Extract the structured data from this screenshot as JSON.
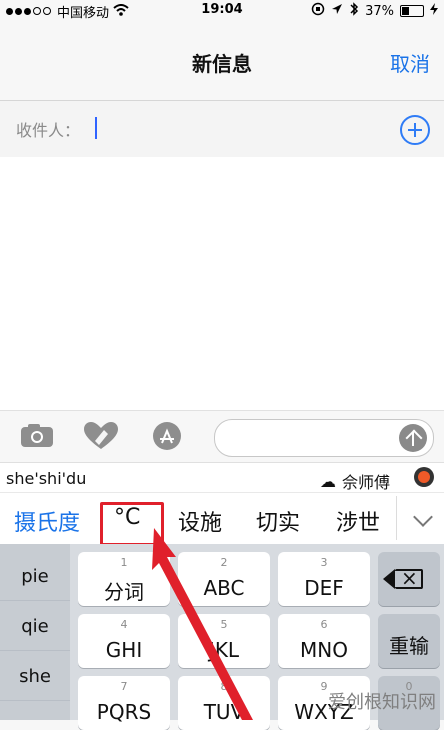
{
  "status": {
    "carrier": "中国移动",
    "time": "19:04",
    "battery_percent": "37%",
    "battery_level": 0.37
  },
  "navbar": {
    "title": "新信息",
    "cancel": "取消"
  },
  "recipient": {
    "label": "收件人："
  },
  "composer": {
    "icons": [
      "camera-icon",
      "digital-touch-icon",
      "app-store-icon",
      "send-icon"
    ]
  },
  "keyboard": {
    "pinyin": "she'shi'du",
    "account": "佘师傅",
    "candidates": [
      "摄氏度",
      "°C",
      "设施",
      "切实",
      "涉世"
    ],
    "side_items": [
      "pie",
      "qie",
      "she"
    ],
    "keys": {
      "row1": [
        {
          "num": "1",
          "label": "分词"
        },
        {
          "num": "2",
          "label": "ABC"
        },
        {
          "num": "3",
          "label": "DEF"
        }
      ],
      "row2": [
        {
          "num": "4",
          "label": "GHI"
        },
        {
          "num": "5",
          "label": "JKL"
        },
        {
          "num": "6",
          "label": "MNO"
        }
      ],
      "row3": [
        {
          "num": "7",
          "label": "PQRS"
        },
        {
          "num": "8",
          "label": "TUV"
        },
        {
          "num": "9",
          "label": "WXYZ"
        },
        {
          "num": "0",
          "label": ""
        }
      ],
      "reenter": "重输"
    }
  },
  "watermark": "爱创根知识网",
  "colors": {
    "accent": "#1a73e8",
    "highlight": "#e0202b"
  }
}
